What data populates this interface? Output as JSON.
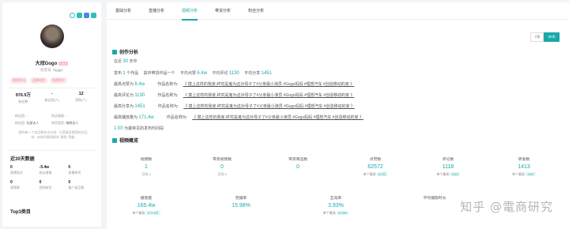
{
  "profile": {
    "name": "大冠Gogo",
    "level": "LV 6",
    "douyin_id": "抖音号: Djgjgo",
    "tags": [
      "德邦快讯",
      "品牌带货",
      "电视购平"
    ],
    "stats": [
      {
        "value": "976.9万",
        "label": "粉丝数"
      },
      {
        "value": "-",
        "label": "粉丝团(人)"
      },
      {
        "value": "12",
        "label": "团购(个)"
      }
    ],
    "kv_left": [
      {
        "label": "粉丝团:",
        "value": "-"
      },
      {
        "label": "粉丝团:",
        "value": "头部达人"
      }
    ],
    "kv_right": [
      {
        "label": "商品橱窗:",
        "value": "-"
      },
      {
        "label": "带货类型:",
        "value": "电商达人"
      }
    ],
    "description": "我的每一个笑话都有水分哈~ 记得要多看我的作品哈~ 有商问题请联系 我哦~我能",
    "recent_title": "近30天数据",
    "recent": [
      {
        "value": "0",
        "label": "直播场次"
      },
      {
        "value": "-5.4w",
        "label": "粉丝增量"
      },
      {
        "value": "0",
        "label": "直播带货"
      },
      {
        "value": "0",
        "label": "视频数"
      },
      {
        "value": "0",
        "label": "视频带货"
      },
      {
        "value": "0",
        "label": "推广商品数"
      }
    ],
    "top3_title": "Top3类目"
  },
  "tabs": [
    "基础分析",
    "直播分析",
    "视频分析",
    "带货分析",
    "粉丝分析"
  ],
  "range": [
    "7天",
    "30天"
  ],
  "creation": {
    "title": "创作分析",
    "period_prefix": "在近",
    "period_value": "30",
    "period_suffix": "天中",
    "line1": {
      "p1": "发布",
      "n1": "1",
      "p2": "个作品",
      "p3": "其中带货作品一个",
      "p4": "平均点赞",
      "n2": "6.4w",
      "p5": "平均评论",
      "n3": "1130",
      "p6": "平均分享",
      "n4": "1451"
    },
    "rows": [
      {
        "label": "最高点赞为",
        "value": "6.4w",
        "name_label": "作品名称为:",
        "link": "《 摸上这样的我家,终究是鬼为这对母子了#父亲最小演员 #Gogo妈妈 #理想汽车 #创造移动的家 》"
      },
      {
        "label": "最高评论为",
        "value": "1130",
        "name_label": "作品名称为:",
        "link": "《 摸上这样的我家,终究是鬼为这对母子了#父亲最小演员 #Gogo妈妈 #理想汽车 #创造移动的家 》"
      },
      {
        "label": "最高分享为",
        "value": "1451",
        "name_label": "作品名称为:",
        "link": "《 摸上这样的我家,终究是鬼为这对母子了#父亲最小演员 #Gogo妈妈 #理想汽车 #创造移动的家 》"
      },
      {
        "label": "最高播放量为",
        "value": "171.4w",
        "name_label": "作品名称为:",
        "link": "《 摸上这样的我家,终究是鬼为这对母子了#父亲最小演员 #Gogo妈妈 #理想汽车 #创造移动的家 》"
      }
    ],
    "best_time_value": "1:00",
    "best_time_text": "为最常见的发布时间段"
  },
  "overview": {
    "title": "视频概览",
    "row1": [
      {
        "label": "视频数",
        "value": "1",
        "sub": "日均 1",
        "badge": ""
      },
      {
        "label": "带货视频数",
        "value": "0",
        "sub": "日均 0",
        "badge": ""
      },
      {
        "label": "带货商品数",
        "value": "0",
        "sub": "",
        "badge": ""
      },
      {
        "label": "点赞数",
        "value": "62572",
        "sub": "单个最高",
        "badge": "6.3万"
      },
      {
        "label": "评论数",
        "value": "1118",
        "sub": "单个最高",
        "badge": "1118"
      },
      {
        "label": "转发数",
        "value": "1413",
        "sub": "单个最高",
        "badge": "1457"
      }
    ],
    "row2": [
      {
        "label": "播放量",
        "value": "165.4w",
        "sub": "单个最高",
        "badge": "171.4万"
      },
      {
        "label": "完播率",
        "value": "15.98%",
        "sub": "",
        "badge": ""
      },
      {
        "label": "互动率",
        "value": "3.93%",
        "sub": "单个最高",
        "badge": "3.93%"
      },
      {
        "label": "平均播放时长",
        "value": "",
        "sub": "",
        "badge": ""
      }
    ]
  },
  "watermark": "知乎 @電商研究"
}
